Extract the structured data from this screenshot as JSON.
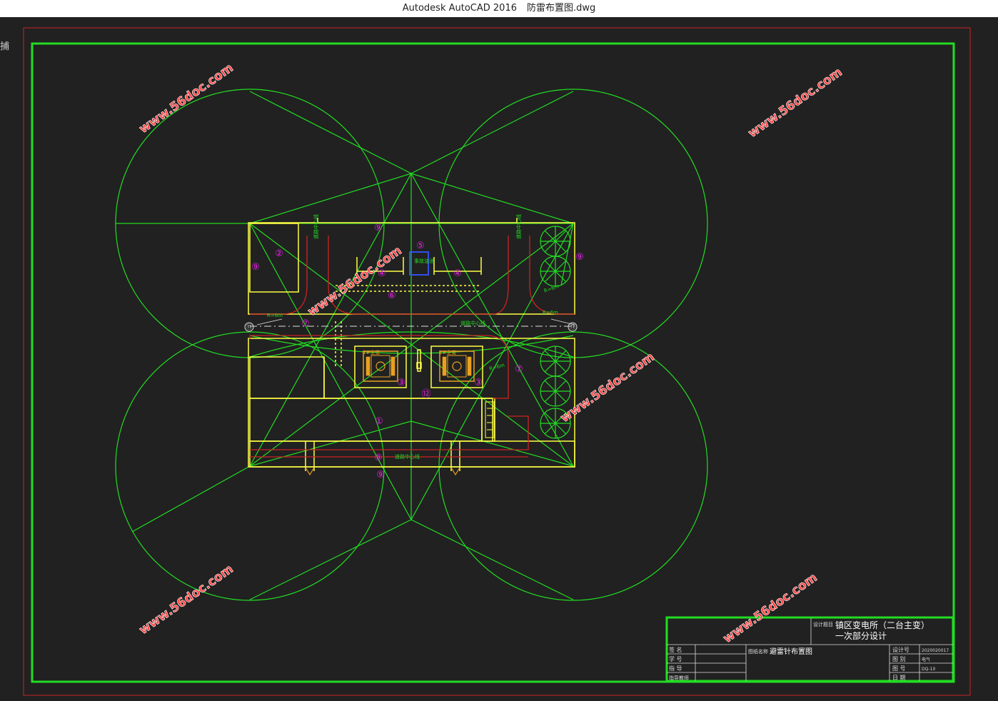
{
  "window": {
    "app": "Autodesk AutoCAD 2016",
    "file": "防雷布置图.dwg"
  },
  "viewport_label": "捕",
  "watermark": "www.56doc.com",
  "labels": {
    "n1": "①",
    "n2": "②",
    "n3": "③",
    "n4": "④",
    "n5": "⑤",
    "n6": "⑥",
    "n7": "⑦",
    "n8": "⑧",
    "n9": "⑨",
    "n11": "⑪",
    "n12": "⑫",
    "road_left_v": "道路中心线",
    "road_right_v": "道路中心线",
    "road_h": "道路中心线",
    "road_bottom": "道路中心线",
    "red_small_left": "R=6m",
    "red_small_right": "R=6m",
    "r_radius_a": "R=6m",
    "r_radius_b": "R=6m",
    "accident_oil": "事故油池",
    "tx1_label": "1#主变",
    "tx2_label": "2#主变"
  },
  "title_block": {
    "project_prefix": "设计题目",
    "project_line1": "镇区变电所（二台主变）",
    "project_line2": "一次部分设计",
    "drawing_prefix": "图纸名称",
    "drawing_name": "避雷针布置图",
    "left_rows": [
      "签 名",
      "学 号",
      "指 导",
      "指导教师"
    ],
    "right_labels": [
      "设计号",
      "图 别",
      "图 号",
      "日 期"
    ],
    "right_values": [
      "2020020017",
      "电气",
      "DQ-10",
      ""
    ]
  },
  "colors": {
    "green": "#22dd22",
    "yellow": "#ffff44",
    "red": "#cc2222",
    "magenta": "#ee22ee",
    "orange": "#e8a020",
    "watermark": "#ff4444"
  }
}
